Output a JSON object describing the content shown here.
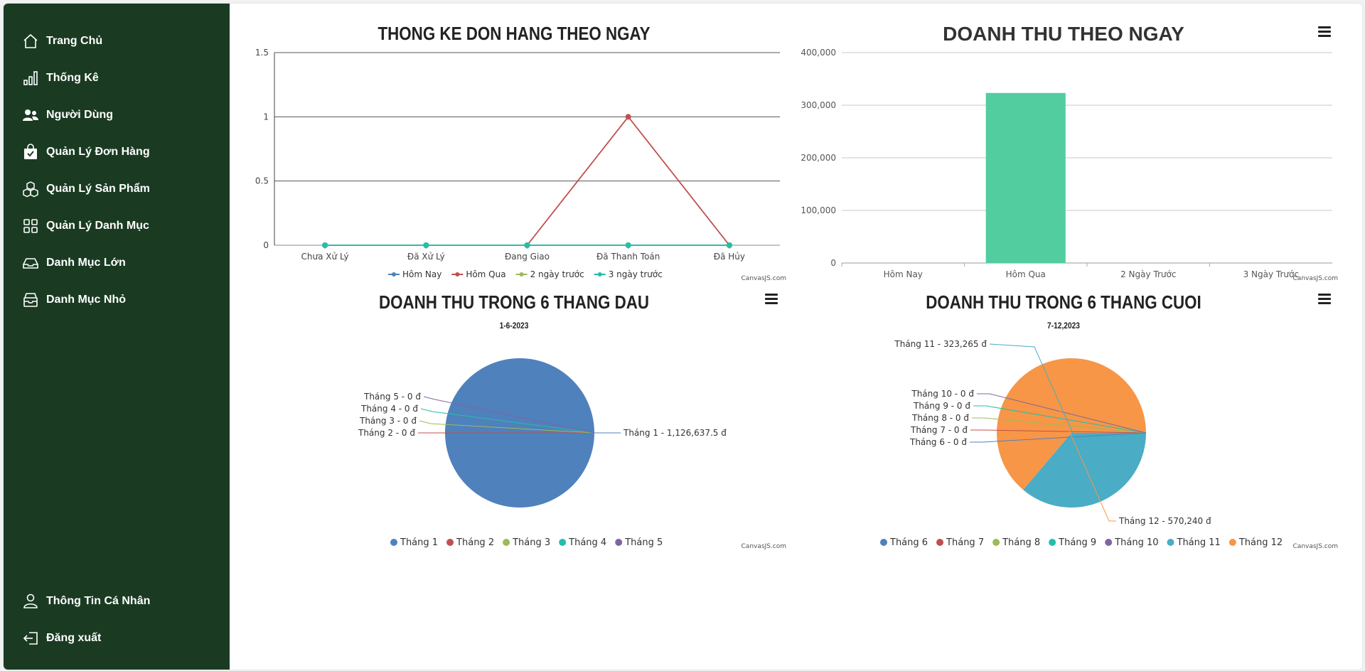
{
  "sidebar": {
    "items": [
      {
        "label": "Trang Chủ",
        "icon": "home-icon"
      },
      {
        "label": "Thống Kê",
        "icon": "bar-chart-icon"
      },
      {
        "label": "Người Dùng",
        "icon": "users-icon"
      },
      {
        "label": "Quản Lý Đơn Hàng",
        "icon": "shopping-bag-icon"
      },
      {
        "label": "Quản Lý Sản Phẩm",
        "icon": "boxes-icon"
      },
      {
        "label": "Quản Lý Danh Mục",
        "icon": "grid-icon"
      },
      {
        "label": "Danh Mục Lớn",
        "icon": "tray-icon"
      },
      {
        "label": "Danh Mục Nhỏ",
        "icon": "archive-icon"
      }
    ],
    "bottom": [
      {
        "label": "Thông Tin Cá Nhân",
        "icon": "user-icon"
      },
      {
        "label": "Đăng xuất",
        "icon": "logout-icon"
      }
    ]
  },
  "credit": "CanvasJS.com",
  "chart_data": [
    {
      "type": "line",
      "title": "THONG KE DON HANG THEO NGAY",
      "categories": [
        "Chưa Xử Lý",
        "Đã Xử Lý",
        "Đang Giao",
        "Đã Thanh Toán",
        "Đã Hủy"
      ],
      "series": [
        {
          "name": "Hôm Nay",
          "values": [
            0,
            0,
            0,
            0,
            0
          ],
          "color": "#4f81bc"
        },
        {
          "name": "Hôm Qua",
          "values": [
            0,
            0,
            0,
            1,
            0
          ],
          "color": "#c0504e"
        },
        {
          "name": "2 ngày trước",
          "values": [
            0,
            0,
            0,
            0,
            0
          ],
          "color": "#9bbb58"
        },
        {
          "name": "3 ngày trước",
          "values": [
            0,
            0,
            0,
            0,
            0
          ],
          "color": "#23bfaa"
        }
      ],
      "ylim": [
        0,
        1.5
      ],
      "yticks": [
        0,
        0.5,
        1,
        1.5
      ],
      "ytick_labels": [
        "0",
        "0.5",
        "1",
        "1.5"
      ],
      "legend": "bottom",
      "grid": true
    },
    {
      "type": "bar",
      "title": "DOANH THU THEO NGAY",
      "categories": [
        "Hôm Nay",
        "Hôm Qua",
        "2 Ngày Trước",
        "3 Ngày Trước"
      ],
      "values": [
        0,
        323265,
        0,
        0
      ],
      "color": "#51cda0",
      "ylim": [
        0,
        400000
      ],
      "yticks": [
        0,
        100000,
        200000,
        300000,
        400000
      ],
      "ytick_labels": [
        "0",
        "100,000",
        "200,000",
        "300,000",
        "400,000"
      ],
      "grid": true
    },
    {
      "type": "pie",
      "title": "DOANH THU TRONG 6 THANG DAU",
      "subtitle": "1-6-2023",
      "labels": [
        "Tháng 1",
        "Tháng 2",
        "Tháng 3",
        "Tháng 4",
        "Tháng 5"
      ],
      "values": [
        1126637.5,
        0,
        0,
        0,
        0
      ],
      "index_labels": [
        "Tháng 1 - 1,126,637.5 đ",
        "Tháng 2 - 0 đ",
        "Tháng 3 - 0 đ",
        "Tháng 4 - 0 đ",
        "Tháng 5 - 0 đ"
      ],
      "colors": [
        "#4f81bc",
        "#c0504e",
        "#9bbb58",
        "#23bfaa",
        "#8064a1"
      ],
      "legend": "bottom"
    },
    {
      "type": "pie",
      "title": "DOANH THU TRONG 6 THANG CUOI",
      "subtitle": "7-12,2023",
      "labels": [
        "Tháng 6",
        "Tháng 7",
        "Tháng 8",
        "Tháng 9",
        "Tháng 10",
        "Tháng 11",
        "Tháng 12"
      ],
      "values": [
        0,
        0,
        0,
        0,
        0,
        323265,
        570240
      ],
      "index_labels": [
        "Tháng 6 - 0 đ",
        "Tháng 7 - 0 đ",
        "Tháng 8 - 0 đ",
        "Tháng 9 - 0 đ",
        "Tháng 10 - 0 đ",
        "Tháng 11 - 323,265 đ",
        "Tháng 12 - 570,240 đ"
      ],
      "colors": [
        "#4f81bc",
        "#c0504e",
        "#9bbb58",
        "#23bfaa",
        "#8064a1",
        "#4aacc5",
        "#f79647"
      ],
      "legend": "bottom"
    }
  ]
}
